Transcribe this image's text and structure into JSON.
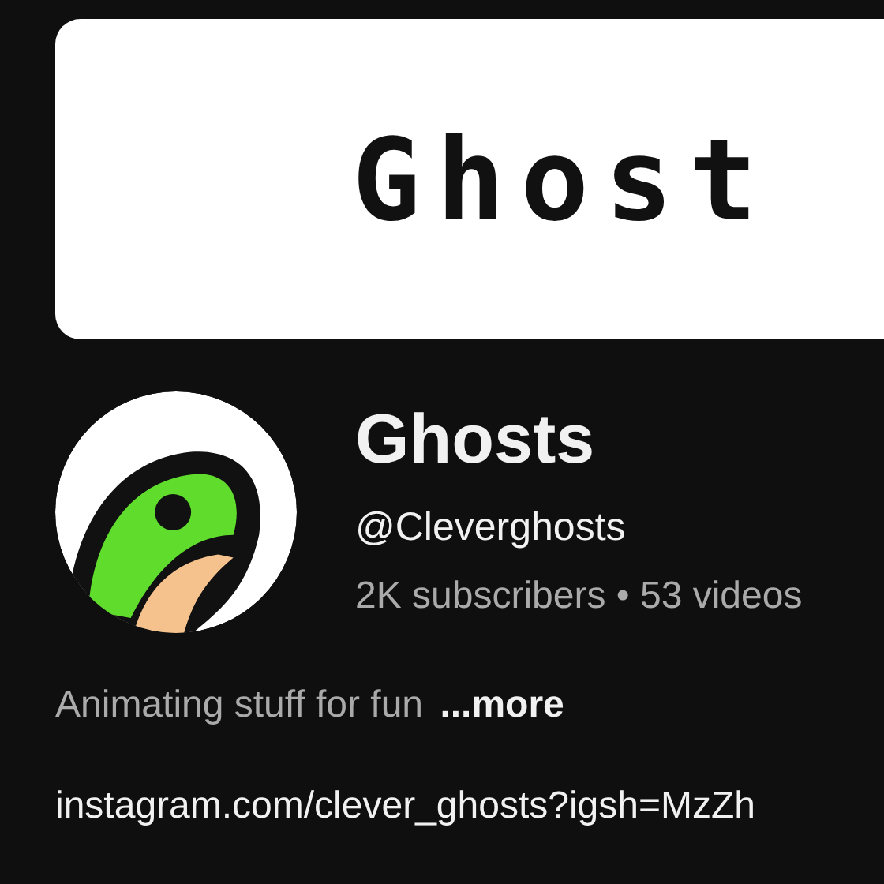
{
  "banner": {
    "text": "Ghost"
  },
  "channel": {
    "name": "Ghosts",
    "handle": "@Cleverghosts",
    "stats": "2K subscribers • 53 videos"
  },
  "description": {
    "text": "Animating stuff for fun",
    "more": "...more"
  },
  "link": "instagram.com/clever_ghosts?igsh=MzZh"
}
